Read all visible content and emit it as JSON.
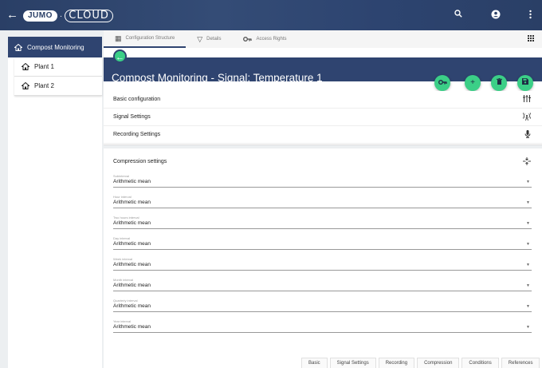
{
  "app": {
    "logo_brand": "JUMO",
    "logo_dot": "·",
    "logo_cloud": "CLOUD"
  },
  "sidebar": {
    "root": "Compost Monitoring",
    "items": [
      {
        "label": "Plant 1"
      },
      {
        "label": "Plant 2"
      }
    ]
  },
  "tabs": [
    {
      "label": "Configuration Structure"
    },
    {
      "label": "Details"
    },
    {
      "label": "Access Rights"
    }
  ],
  "header": {
    "title_prefix": "Compost Monitoring - ",
    "title_main": "Signal: Temperature 1"
  },
  "sections": [
    {
      "label": "Basic configuration",
      "icon": "equalizer-icon"
    },
    {
      "label": "Signal Settings",
      "icon": "antenna-icon"
    },
    {
      "label": "Recording Settings",
      "icon": "microphone-icon"
    }
  ],
  "compression": {
    "header": "Compression settings",
    "fields": [
      {
        "label": "Subinterval",
        "value": "Arithmetic mean"
      },
      {
        "label": "Hour interval",
        "value": "Arithmetic mean"
      },
      {
        "label": "Two hours interval",
        "value": "Arithmetic mean"
      },
      {
        "label": "Day interval",
        "value": "Arithmetic mean"
      },
      {
        "label": "Week interval",
        "value": "Arithmetic mean"
      },
      {
        "label": "Month interval",
        "value": "Arithmetic mean"
      },
      {
        "label": "Quarterly interval",
        "value": "Arithmetic mean"
      },
      {
        "label": "Year interval",
        "value": "Arithmetic mean"
      }
    ]
  },
  "bottom_tabs": [
    "Basic",
    "Signal Settings",
    "Recording",
    "Compression",
    "Conditions",
    "References"
  ],
  "colors": {
    "navy": "#2f4470",
    "accent_green": "#3bcf87"
  }
}
